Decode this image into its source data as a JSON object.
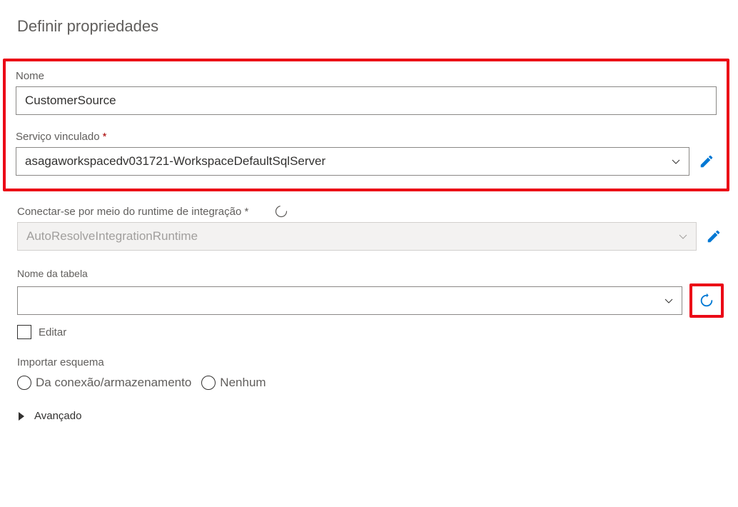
{
  "title": "Definir propriedades",
  "name": {
    "label": "Nome",
    "value": "CustomerSource"
  },
  "linkedService": {
    "label": "Serviço vinculado",
    "value": "asagaworkspacedv031721-WorkspaceDefaultSqlServer"
  },
  "integrationRuntime": {
    "label": "Conectar-se por meio do runtime de integração *",
    "value": "AutoResolveIntegrationRuntime"
  },
  "tableName": {
    "label": "Nome da tabela",
    "value": ""
  },
  "editCheckbox": {
    "label": "Editar",
    "checked": false
  },
  "importSchema": {
    "label": "Importar esquema",
    "option1": "Da conexão/armazenamento",
    "option2": "Nenhum"
  },
  "advanced": {
    "label": "Avançado"
  },
  "colors": {
    "highlight": "#eb0716",
    "primary": "#0078d4"
  }
}
